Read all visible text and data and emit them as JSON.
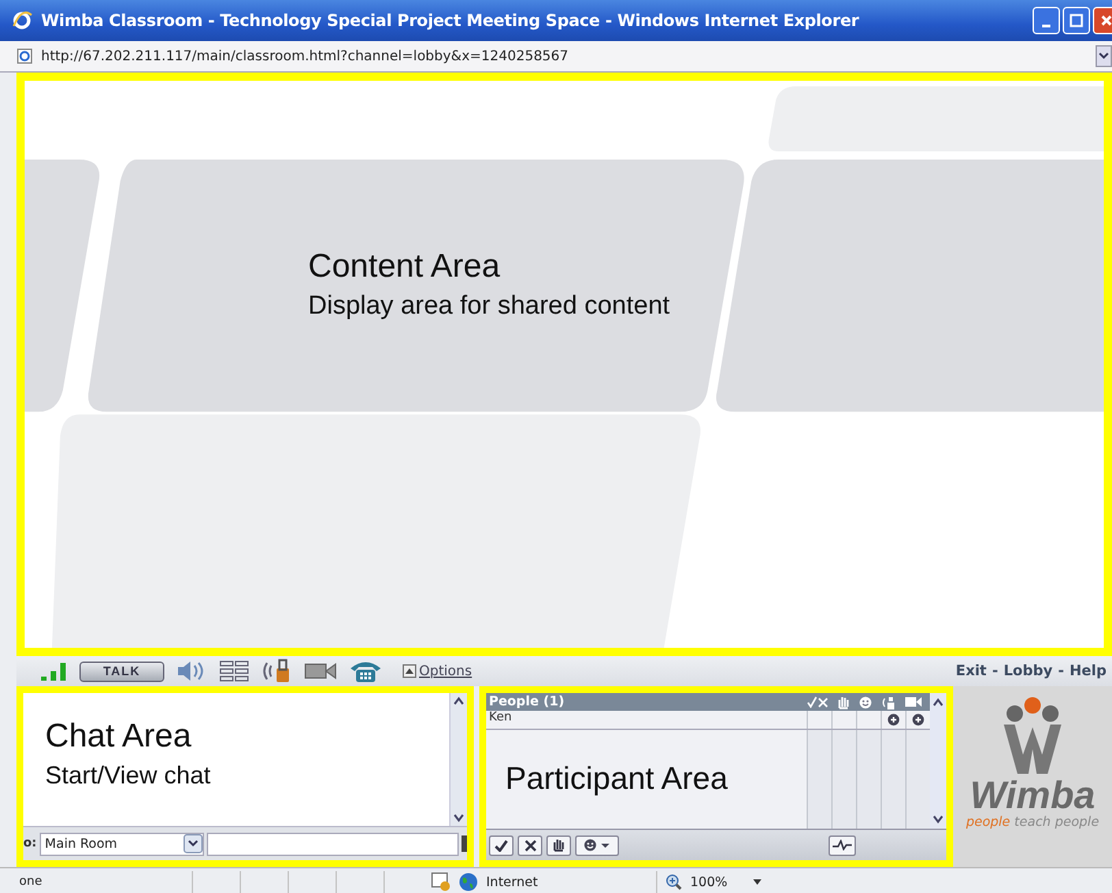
{
  "window": {
    "title": "Wimba Classroom - Technology Special Project Meeting Space - Windows Internet Explorer"
  },
  "address_bar": {
    "url": "http://67.202.211.117/main/classroom.html?channel=lobby&x=1240258567"
  },
  "content_area": {
    "title": "Content Area",
    "subtitle": "Display area for shared content"
  },
  "toolbar": {
    "talk_button": "TALK",
    "options_link": "Options",
    "nav_links": [
      "Exit",
      "Lobby",
      "Help"
    ],
    "separator": "-"
  },
  "chat": {
    "title": "Chat Area",
    "subtitle": "Start/View chat",
    "to_label": "o:",
    "room": "Main Room"
  },
  "people": {
    "header": "People (1)",
    "rows": [
      {
        "name": "Ken"
      }
    ],
    "overlay": "Participant Area"
  },
  "logo": {
    "name": "Wimba",
    "tagline_accent": "people",
    "tagline_rest": "teach people"
  },
  "status_bar": {
    "status": "one",
    "zone": "Internet",
    "zoom": "100%"
  }
}
